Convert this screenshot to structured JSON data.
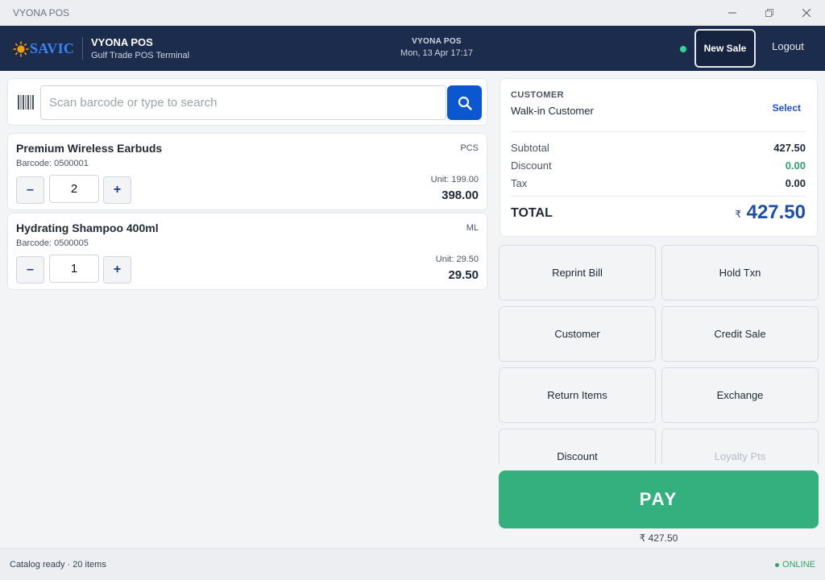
{
  "window": {
    "title": "VYONA POS",
    "minimize": "—",
    "maximize": "❐",
    "close": "✕"
  },
  "header": {
    "logo_text": "SAVIC",
    "app_name": "VYONA POS",
    "terminal": "Gulf Trade POS Terminal",
    "center_title": "VYONA POS",
    "datetime": "Mon, 13 Apr   17:17",
    "new_sale": "New Sale",
    "logout": "Logout",
    "status_color": "#34d399"
  },
  "search": {
    "placeholder": "Scan barcode or type to search",
    "value": ""
  },
  "cart": {
    "items": [
      {
        "name": "Premium Wireless Earbuds",
        "barcode": "Barcode: 0500001",
        "uom": "PCS",
        "qty": "2",
        "unit_price": "Unit: 199.00",
        "line_total": "398.00"
      },
      {
        "name": "Hydrating Shampoo 400ml",
        "barcode": "Barcode: 0500005",
        "uom": "ML",
        "qty": "1",
        "unit_price": "Unit: 29.50",
        "line_total": "29.50"
      }
    ],
    "minus": "–",
    "plus": "+"
  },
  "summary": {
    "customer_label": "CUSTOMER",
    "customer_name": "Walk-in Customer",
    "select": "Select",
    "subtotal_label": "Subtotal",
    "subtotal": "427.50",
    "discount_label": "Discount",
    "discount": "0.00",
    "tax_label": "Tax",
    "tax": "0.00",
    "total_label": "TOTAL",
    "currency": "₹",
    "total": "427.50"
  },
  "actions": {
    "reprint": "Reprint Bill",
    "hold": "Hold Txn",
    "customer": "Customer",
    "credit": "Credit Sale",
    "return": "Return Items",
    "exchange": "Exchange",
    "discount": "Discount",
    "loyalty": "Loyalty Pts"
  },
  "pay": {
    "label": "PAY",
    "amount": "₹ 427.50"
  },
  "statusbar": {
    "left": "Catalog ready · 20 items",
    "right": "ONLINE"
  },
  "colors": {
    "header_bg": "#1c2c4c",
    "accent_blue": "#0b57d0",
    "pay_green": "#33b07e",
    "positive": "#2fa36b"
  }
}
